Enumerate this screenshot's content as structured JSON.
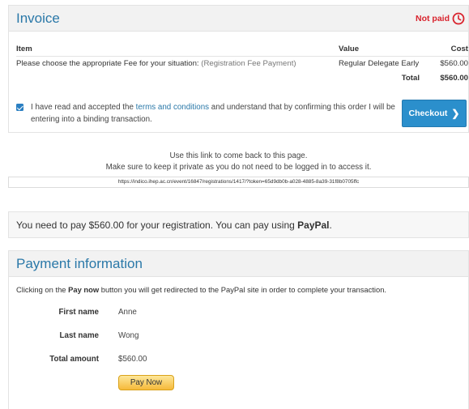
{
  "invoice": {
    "title": "Invoice",
    "status": "Not paid",
    "table": {
      "headers": {
        "item": "Item",
        "value": "Value",
        "cost": "Cost"
      },
      "row": {
        "item_prefix": "Please choose the appropriate Fee for your situation:",
        "item_choice": "(Registration Fee Payment)",
        "value": "Regular Delegate Early",
        "cost": "$560.00"
      },
      "total_label": "Total",
      "total_value": "$560.00"
    },
    "agreement": {
      "text_before": "I have read and accepted the",
      "link_text": "terms and conditions",
      "text_after": "and understand that by confirming this order I will be entering into a binding transaction.",
      "checked": true
    },
    "checkout_label": "Checkout"
  },
  "link_info": {
    "line1": "Use this link to come back to this page.",
    "line2": "Make sure to keep it private as you do not need to be logged in to access it.",
    "url": "https://indico.ihep.ac.cn/event/16847/registrations/1417/?token=65d9db0b-a028-4885-8a39-31f8b0705ffc"
  },
  "pay_banner": {
    "text_before": "You need to pay $560.00 for your registration. You can pay using",
    "method": "PayPal",
    "text_after": "."
  },
  "payment": {
    "title": "Payment information",
    "redirect_before": "Clicking on the",
    "redirect_button": "Pay now",
    "redirect_after": "button you will get redirected to the PayPal site in order to complete your transaction.",
    "fields": {
      "first_name_label": "First name",
      "first_name_value": "Anne",
      "last_name_label": "Last name",
      "last_name_value": "Wong",
      "total_label": "Total amount",
      "total_value": "$560.00"
    },
    "pay_now_label": "Pay Now"
  },
  "colors": {
    "accent": "#2a78a8",
    "status_red": "#d9232d",
    "checkout_blue": "#2b8fcc",
    "paypal_gold": "#f6b93a"
  },
  "icons": {
    "status": "clock-icon",
    "checkbox": "checkbox-checked-icon",
    "checkout": "chevron-right-icon"
  }
}
